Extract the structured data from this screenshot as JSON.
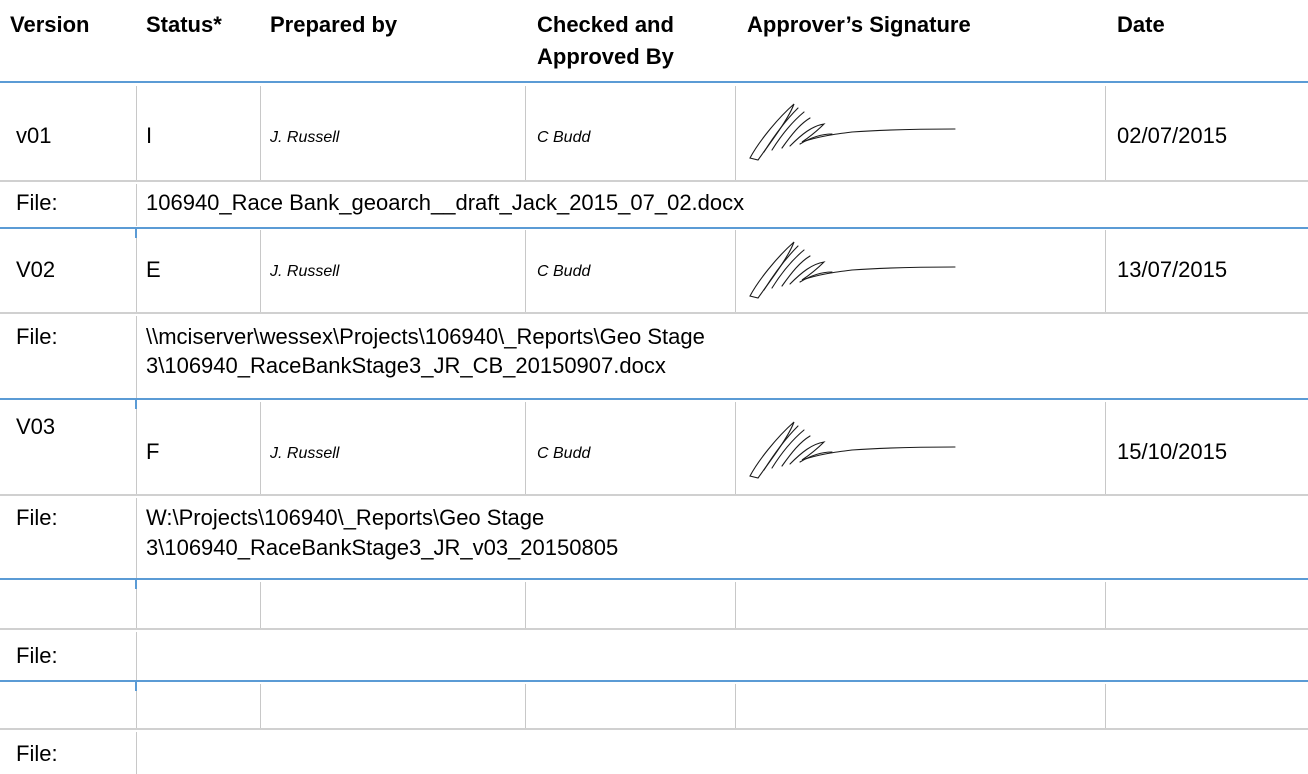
{
  "header": {
    "version": "Version",
    "status": "Status*",
    "prepared_by": "Prepared by",
    "checked_line1": "Checked and",
    "checked_line2": "Approved By",
    "signature": "Approver’s Signature",
    "date": "Date"
  },
  "rows": [
    {
      "version": "v01",
      "status": "I",
      "prepared_by": "J. Russell",
      "checked_by": "C Budd",
      "signature": "handwritten-signature",
      "date": "02/07/2015",
      "file_label": "File:",
      "file_line1": "106940_Race Bank_geoarch__draft_Jack_2015_07_02.docx",
      "file_line2": ""
    },
    {
      "version": "V02",
      "status": "E",
      "prepared_by": "J. Russell",
      "checked_by": "C Budd",
      "signature": "handwritten-signature",
      "date": "13/07/2015",
      "file_label": "File:",
      "file_line1": "\\\\mciserver\\wessex\\Projects\\106940\\_Reports\\Geo Stage",
      "file_line2": "3\\106940_RaceBankStage3_JR_CB_20150907.docx"
    },
    {
      "version": "V03",
      "status": "F",
      "prepared_by": "J. Russell",
      "checked_by": "C Budd",
      "signature": "handwritten-signature",
      "date": "15/10/2015",
      "file_label": "File:",
      "file_line1": "W:\\Projects\\106940\\_Reports\\Geo Stage",
      "file_line2": "3\\106940_RaceBankStage3_JR_v03_20150805"
    },
    {
      "version": "",
      "status": "",
      "prepared_by": "",
      "checked_by": "",
      "signature": "",
      "date": "",
      "file_label": "File:",
      "file_line1": "",
      "file_line2": ""
    },
    {
      "version": "",
      "status": "",
      "prepared_by": "",
      "checked_by": "",
      "signature": "",
      "date": "",
      "file_label": "File:",
      "file_line1": "",
      "file_line2": ""
    }
  ],
  "colors": {
    "rule": "#5b9bd5",
    "grid": "#d0d0d0"
  }
}
